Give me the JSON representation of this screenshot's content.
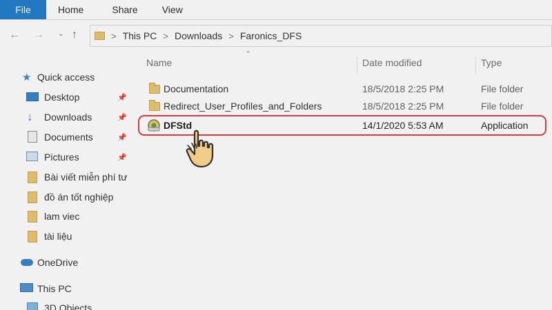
{
  "ribbon": {
    "tabs": [
      "File",
      "Home",
      "Share",
      "View"
    ]
  },
  "nav": {
    "breadcrumb": [
      "This PC",
      "Downloads",
      "Faronics_DFS"
    ]
  },
  "sidebar": {
    "items": [
      {
        "label": "Quick access",
        "icon": "star-icon"
      },
      {
        "label": "Desktop",
        "icon": "desktop-icon",
        "pinned": true
      },
      {
        "label": "Downloads",
        "icon": "download-arrow-icon",
        "pinned": true
      },
      {
        "label": "Documents",
        "icon": "document-icon",
        "pinned": true
      },
      {
        "label": "Pictures",
        "icon": "pictures-icon",
        "pinned": true
      },
      {
        "label": "Bài viết miễn phí tư",
        "icon": "folder-icon"
      },
      {
        "label": "đồ án tốt nghiệp",
        "icon": "folder-icon"
      },
      {
        "label": "lam viec",
        "icon": "folder-icon"
      },
      {
        "label": "tài liệu",
        "icon": "folder-icon"
      },
      {
        "label": "OneDrive",
        "icon": "cloud-icon"
      },
      {
        "label": "This PC",
        "icon": "computer-icon"
      },
      {
        "label": "3D Objects",
        "icon": "cube-icon"
      }
    ]
  },
  "columns": {
    "name": "Name",
    "date": "Date modified",
    "type": "Type"
  },
  "files": [
    {
      "name": "Documentation",
      "date": "18/5/2018 2:25 PM",
      "type": "File folder"
    },
    {
      "name": "Redirect_User_Profiles_and_Folders",
      "date": "18/5/2018 2:25 PM",
      "type": "File folder"
    },
    {
      "name": "DFStd",
      "date": "14/1/2020 5:53 AM",
      "type": "Application"
    }
  ],
  "colors": {
    "accent": "#1979ca",
    "highlight_border": "#e0343a",
    "folder": "#e9c46a"
  }
}
